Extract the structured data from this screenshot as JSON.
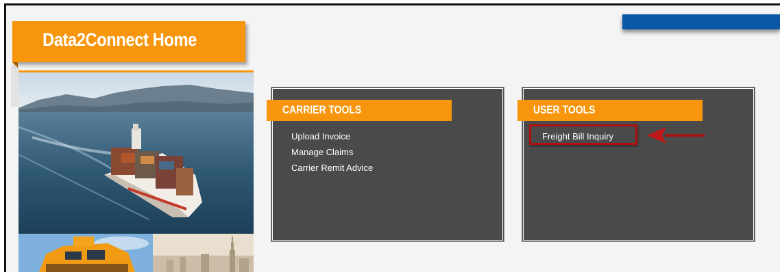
{
  "header": {
    "title": "Data2Connect Home"
  },
  "carrier_tools": {
    "heading": "CARRIER TOOLS",
    "links": [
      "Upload Invoice",
      "Manage Claims",
      "Carrier Remit Advice"
    ]
  },
  "user_tools": {
    "heading": "USER TOOLS",
    "links": [
      "Freight Bill Inquiry"
    ]
  },
  "icons": [
    "arrow-left-icon"
  ],
  "colors": {
    "accent_orange": "#f7960c",
    "panel_gray": "#4a4a4a",
    "top_bar_blue": "#0b57a8",
    "highlight_red": "#b01010"
  }
}
